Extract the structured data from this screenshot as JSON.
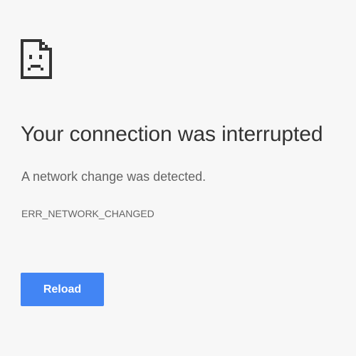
{
  "colors": {
    "accent": "#4285f4",
    "background": "#f7f7f7",
    "headline": "#333333",
    "secondary_text": "#646464"
  },
  "icon": "sad-page-icon",
  "error": {
    "headline": "Your connection was interrupted",
    "message": "A network change was detected.",
    "code": "ERR_NETWORK_CHANGED"
  },
  "actions": {
    "reload_label": "Reload"
  }
}
